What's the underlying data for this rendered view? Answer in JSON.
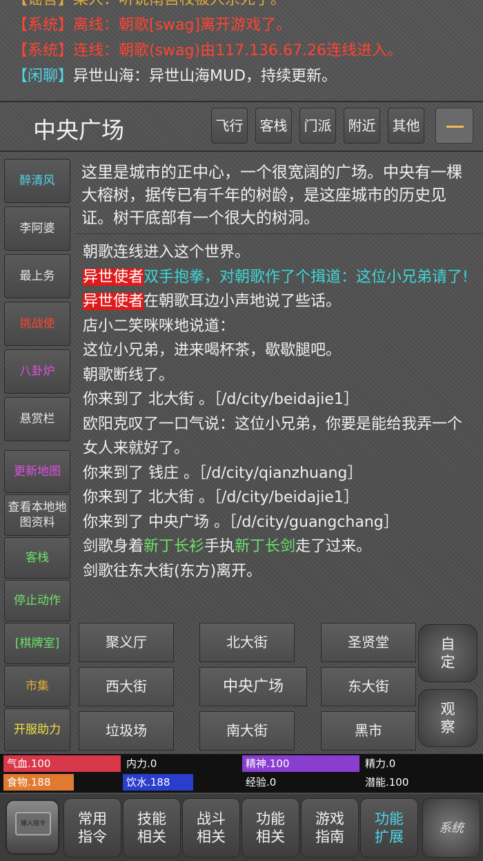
{
  "chat": [
    {
      "channel": "【谣言】",
      "text": "某人：听说南宫校被人杀死了。",
      "color": "#e0ac3a"
    },
    {
      "channel": "【系统】",
      "text": "离线：朝歌[swag]离开游戏了。",
      "color": "#ff4433"
    },
    {
      "channel": "【系统】",
      "text": "连线：朝歌(swag)由117.136.67.26连线进入。",
      "color": "#ff4433"
    },
    {
      "channel": "【闲聊】",
      "text": "异世山海：异世山海MUD，持续更新。",
      "color": "#4fd4e8"
    }
  ],
  "header": {
    "room_title": "中央广场",
    "buttons": [
      "飞行",
      "客栈",
      "门派",
      "附近",
      "其他"
    ]
  },
  "left_nav": [
    {
      "label": "醉清风",
      "color": "#4fd4e8"
    },
    {
      "label": "李阿婆",
      "color": "#e8e8e8"
    },
    {
      "label": "最上务",
      "color": "#e8e8e8"
    },
    {
      "label": "挑战使",
      "color": "#ff4433"
    },
    {
      "label": "八卦炉",
      "color": "#e050e0"
    },
    {
      "label": "悬赏栏",
      "color": "#e8e8e8"
    },
    {
      "label": "更新地图",
      "color": "#e050e0"
    },
    {
      "label": "查看本地地图资料",
      "color": "#e8e8e8"
    },
    {
      "label": "客栈",
      "color": "#6be36b"
    },
    {
      "label": "停止动作",
      "color": "#6be36b"
    },
    {
      "label": "[棋牌室]",
      "color": "#6be36b"
    },
    {
      "label": "市集",
      "color": "#e0ac3a"
    },
    {
      "label": "开服助力",
      "color": "#f0e040"
    }
  ],
  "room_description": "这里是城市的正中心，一个很宽阔的广场。中央有一棵大榕树，据传已有千年的树龄，是这座城市的历史见证。树干底部有一个很大的树洞。",
  "log": {
    "l1": "朝歌连线进入这个世界。",
    "l2_tag": "异世使者",
    "l2_text": "双手抱拳，对朝歌作了个揖道：这位小兄弟请了!",
    "l3_tag": "异世使者",
    "l3_text": "在朝歌耳边小声地说了些话。",
    "l4": "店小二笑咪咪地说道：",
    "l5": "这位小兄弟，进来喝杯茶，歇歇腿吧。",
    "l6": "朝歌断线了。",
    "l7": "你来到了 北大街 。［/d/city/beidajie1］",
    "l8": "欧阳克叹了一口气说：这位小兄弟，你要是能给我弄一个女人来就好了。",
    "l9": "你来到了 钱庄 。［/d/city/qianzhuang］",
    "l10": "你来到了 北大街 。［/d/city/beidajie1］",
    "l11": "你来到了 中央广场 。［/d/city/guangchang］",
    "l12_a": "剑歌身着",
    "l12_b": "新丁长衫",
    "l12_c": "手执",
    "l12_d": "新丁长剑",
    "l12_e": "走了过来。",
    "l13": "剑歌往东大街(东方)离开。"
  },
  "map": {
    "north_west": "聚义厅",
    "north": "北大街",
    "north_east": "圣贤堂",
    "west": "西大街",
    "center": "中央广场",
    "east": "东大街",
    "south_west": "垃圾场",
    "south": "南大街",
    "south_east": "黑市",
    "custom": "自定",
    "observe": "观察"
  },
  "stats": [
    {
      "label": "气血.100",
      "color": "#d8384a",
      "fraction": 1.0
    },
    {
      "label": "内力.0",
      "color": "#6a6a6a",
      "fraction": 0.0
    },
    {
      "label": "精神.100",
      "color": "#8a3ed0",
      "fraction": 1.0
    },
    {
      "label": "精力.0",
      "color": "#6a6a6a",
      "fraction": 0.0
    },
    {
      "label": "食物.188",
      "color": "#e07a30",
      "fraction": 0.6
    },
    {
      "label": "饮水.188",
      "color": "#2a3ecc",
      "fraction": 0.6
    },
    {
      "label": "经验.0",
      "color": "#6a6a6a",
      "fraction": 0.0
    },
    {
      "label": "潜能.100",
      "color": "#6a6a6a",
      "fraction": 0.0
    }
  ],
  "bottom": {
    "input_label": "输入指令",
    "buttons": [
      "常用\n指令",
      "技能\n相关",
      "战斗\n相关",
      "功能\n相关",
      "游戏\n指南",
      "功能\n扩展"
    ],
    "system_label": "系统"
  }
}
